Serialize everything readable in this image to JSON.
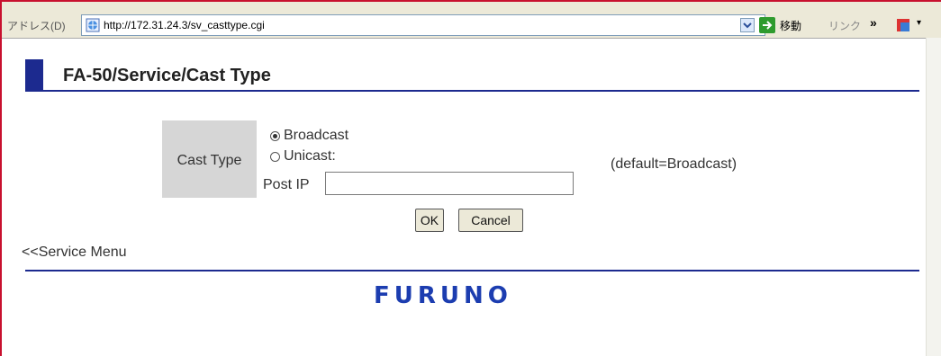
{
  "address_bar": {
    "label": "アドレス(D)",
    "url": "http://172.31.24.3/sv_casttype.cgi",
    "go_label": "移動",
    "links_label": "リンク",
    "more_label": "»"
  },
  "header": {
    "title": "FA-50/Service/Cast Type"
  },
  "form": {
    "cast_type_label": "Cast Type",
    "options": [
      {
        "label": "Broadcast",
        "selected": true
      },
      {
        "label": "Unicast:",
        "selected": false
      }
    ],
    "post_ip_label": "Post IP",
    "post_ip_value": "",
    "default_note": "(default=Broadcast)",
    "ok_label": "OK",
    "cancel_label": "Cancel"
  },
  "footer": {
    "service_menu_link": "<<Service Menu",
    "logo_text": "FURUNO"
  },
  "colors": {
    "accent": "#1c2a8f",
    "logo": "#1c3db0",
    "cell_bg": "#d6d6d6"
  }
}
